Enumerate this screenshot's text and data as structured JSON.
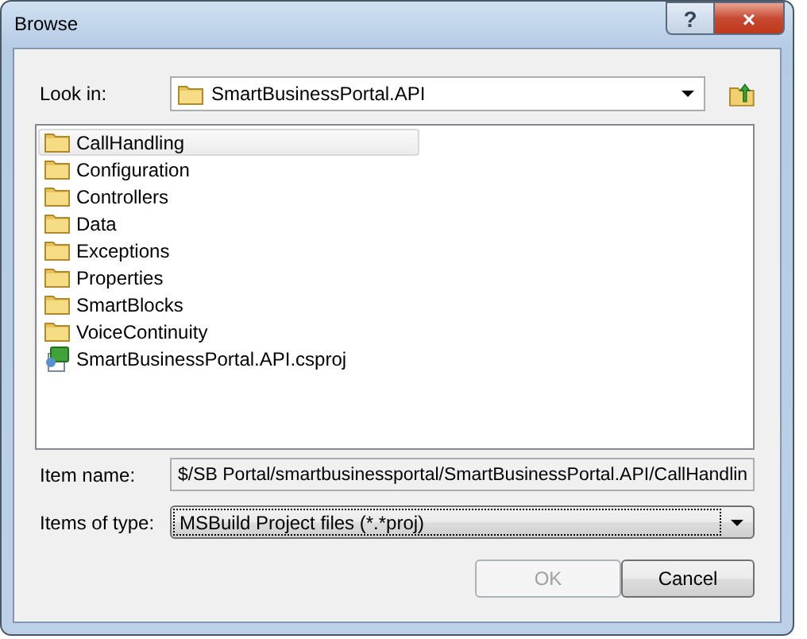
{
  "window": {
    "title": "Browse",
    "help_button": "?",
    "close_button": "×"
  },
  "look_in": {
    "label": "Look in:",
    "value": "SmartBusinessPortal.API"
  },
  "items": [
    {
      "kind": "folder",
      "label": "CallHandling",
      "selected": true
    },
    {
      "kind": "folder",
      "label": "Configuration",
      "selected": false
    },
    {
      "kind": "folder",
      "label": "Controllers",
      "selected": false
    },
    {
      "kind": "folder",
      "label": "Data",
      "selected": false
    },
    {
      "kind": "folder",
      "label": "Exceptions",
      "selected": false
    },
    {
      "kind": "folder",
      "label": "Properties",
      "selected": false
    },
    {
      "kind": "folder",
      "label": "SmartBlocks",
      "selected": false
    },
    {
      "kind": "folder",
      "label": "VoiceContinuity",
      "selected": false
    },
    {
      "kind": "project",
      "label": "SmartBusinessPortal.API.csproj",
      "selected": false
    }
  ],
  "item_name": {
    "label": "Item name:",
    "value": "$/SB Portal/smartbusinessportal/SmartBusinessPortal.API/CallHandlin"
  },
  "items_of_type": {
    "label": "Items of type:",
    "value": "MSBuild Project files (*.*proj)"
  },
  "buttons": [
    {
      "label": "OK",
      "disabled": true
    },
    {
      "label": "Cancel",
      "disabled": false
    }
  ]
}
